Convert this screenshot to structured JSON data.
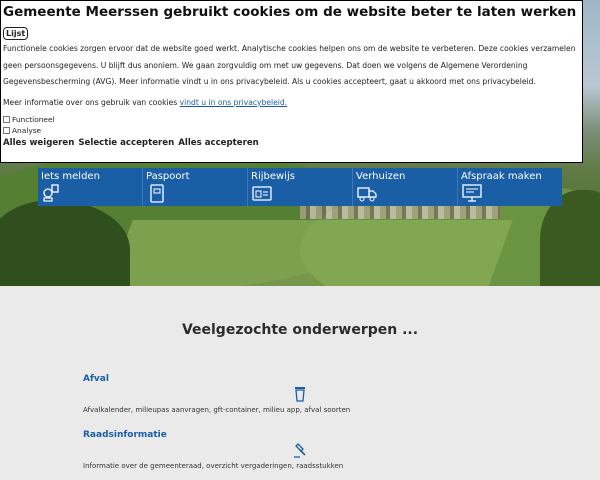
{
  "cookie_dialog": {
    "title": "Gemeente Meerssen gebruikt cookies om de website beter te laten werken",
    "list_button": "Lijst",
    "description": "Functionele cookies zorgen ervoor dat de website goed werkt. Analytische cookies helpen ons om de website te verbeteren. Deze cookies verzamelen geen persoonsgegevens. U blijft dus anoniem. We gaan zorgvuldig om met uw gegevens. Dat doen we volgens de Algemene Verordening Gegevensbescherming (AVG). Meer informatie vindt u in ons privacybeleid. Als u cookies accepteert, gaat u akkoord met ons privacybeleid.",
    "more_info_text": "Meer informatie over ons gebruik van cookies",
    "more_info_link": "vindt u in ons privacybeleid.",
    "options": [
      "Functioneel",
      "Analyse"
    ],
    "buttons": {
      "reject_all": "Alles weigeren",
      "accept_selection": "Selectie accepteren",
      "accept_all": "Alles accepteren"
    }
  },
  "quick_links": [
    {
      "label": "Iets melden",
      "icon": "report-icon"
    },
    {
      "label": "Paspoort",
      "icon": "passport-icon"
    },
    {
      "label": "Rijbewijs",
      "icon": "driving-license-icon"
    },
    {
      "label": "Verhuizen",
      "icon": "moving-truck-icon"
    },
    {
      "label": "Afspraak maken",
      "icon": "appointment-monitor-icon"
    }
  ],
  "main": {
    "section_title": "Veelgezochte onderwerpen ...",
    "topics": [
      {
        "title": "Afval",
        "description": "Afvalkalender, milieupas aanvragen, gft-container, milieu app, afval soorten",
        "icon": "waste-bin-icon"
      },
      {
        "title": "Raadsinformatie",
        "description": "Informatie over de gemeenteraad, overzicht vergaderingen, raadsstukken",
        "icon": "gavel-icon"
      }
    ]
  },
  "colors": {
    "accent": "#1a5ea6",
    "link": "#1a5ea6"
  }
}
